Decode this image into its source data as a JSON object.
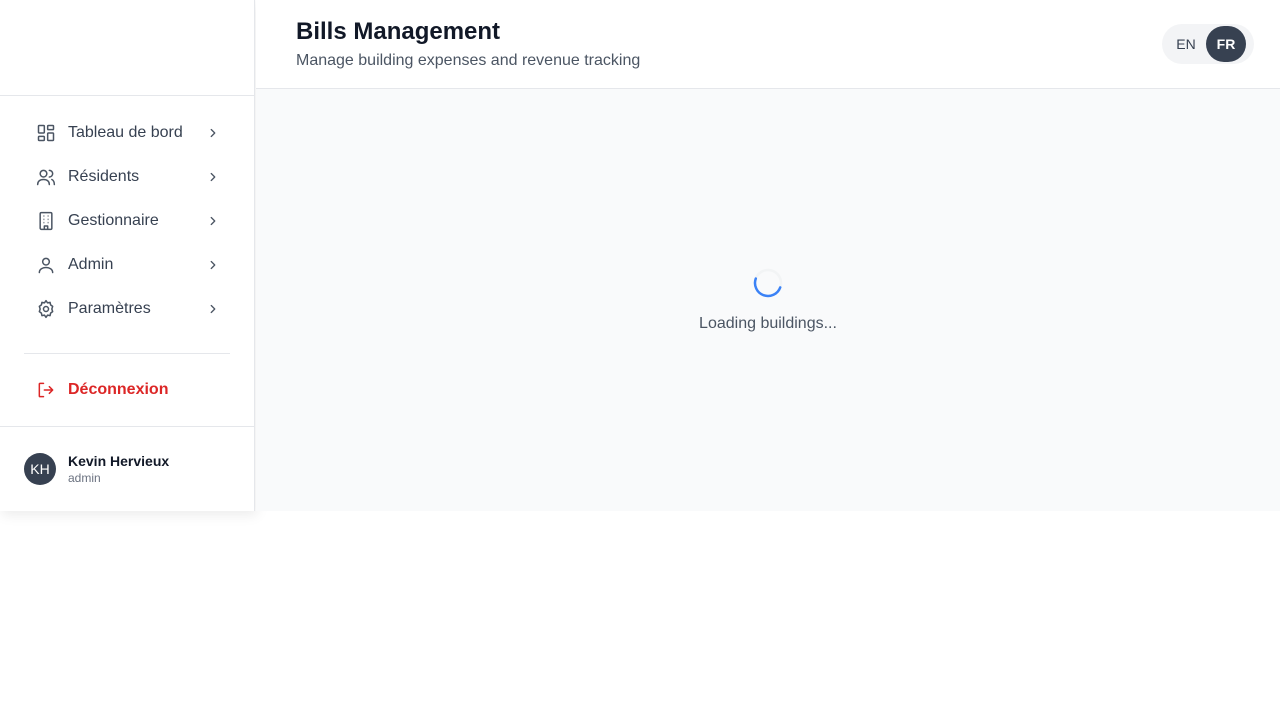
{
  "header": {
    "title": "Bills Management",
    "subtitle": "Manage building expenses and revenue tracking"
  },
  "language": {
    "options": [
      "EN",
      "FR"
    ],
    "selected": "FR"
  },
  "sidebar": {
    "items": [
      {
        "label": "Tableau de bord",
        "icon": "dashboard-icon"
      },
      {
        "label": "Résidents",
        "icon": "users-icon"
      },
      {
        "label": "Gestionnaire",
        "icon": "building-icon"
      },
      {
        "label": "Admin",
        "icon": "user-icon"
      },
      {
        "label": "Paramètres",
        "icon": "gear-icon"
      }
    ],
    "logout": {
      "label": "Déconnexion",
      "icon": "logout-icon"
    }
  },
  "user": {
    "initials": "KH",
    "name": "Kevin Hervieux",
    "role": "admin"
  },
  "main": {
    "loading_text": "Loading buildings..."
  },
  "colors": {
    "accent": "#3b82f6",
    "danger": "#dc2626",
    "dark": "#374151"
  }
}
